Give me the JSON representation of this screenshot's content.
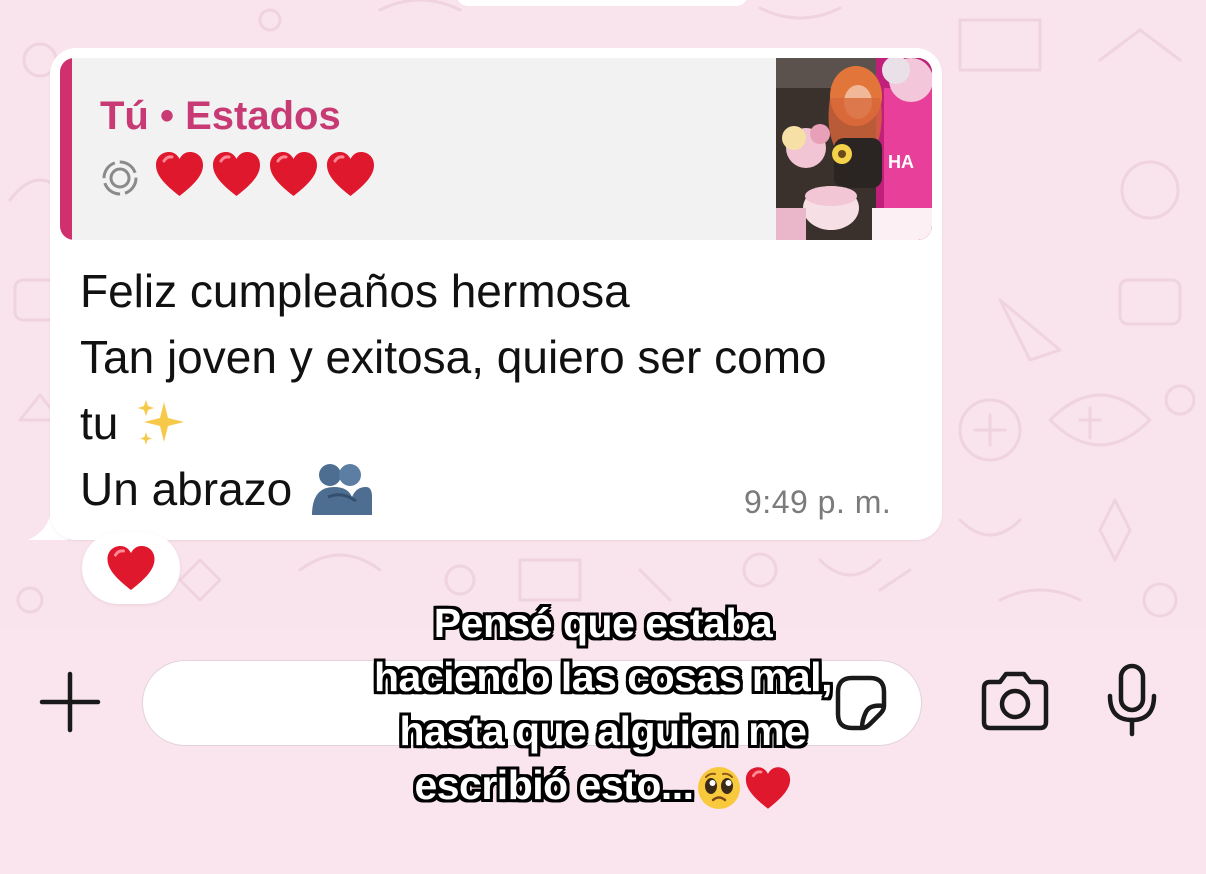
{
  "colors": {
    "wallpaper": "#f9e3ec",
    "wallpaper_pattern": "#e7c6d4",
    "bubble": "#ffffff",
    "quote_background": "#f2f2f2",
    "quote_accent": "#d0306e",
    "quote_author": "#c73a73",
    "message_text": "#111111",
    "timestamp": "#7b7b7b",
    "heart": "#e0182d"
  },
  "quoted_status": {
    "author": "Tú • Estados",
    "status_icon": "status-ring-icon",
    "hearts": [
      "heart",
      "heart",
      "heart",
      "heart"
    ],
    "thumbnail": "birthday-photo-thumbnail"
  },
  "message": {
    "lines": [
      "Feliz cumpleaños hermosa",
      "Tan joven y exitosa, quiero ser como",
      "tu",
      "Un abrazo"
    ],
    "line3_emoji": "sparkles-emoji",
    "line4_emoji": "people-hugging-emoji",
    "time": "9:49 p. m."
  },
  "reaction": {
    "emoji": "red-heart-emoji"
  },
  "composer": {
    "attach_icon": "plus-icon",
    "input_value": "",
    "sticker_icon": "sticker-icon",
    "camera_icon": "camera-icon",
    "mic_icon": "microphone-icon"
  },
  "overlay_caption": {
    "lines": [
      "Pensé que estaba",
      "haciendo las cosas mal,",
      "hasta que alguien me",
      "escribió esto..."
    ],
    "trailing_emojis": [
      "pleading-face-emoji",
      "red-heart-emoji"
    ]
  }
}
